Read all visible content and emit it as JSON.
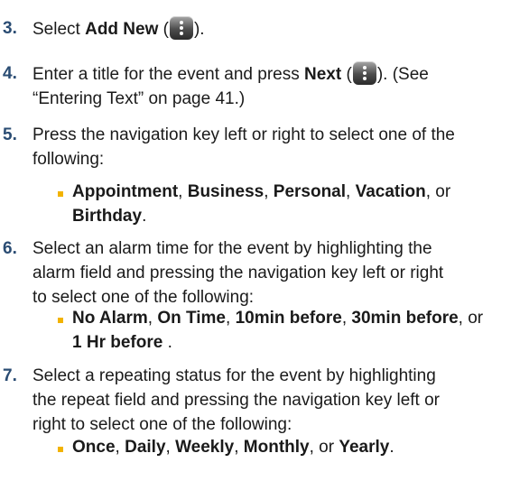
{
  "step3": {
    "num": "3.",
    "pre": "Select ",
    "bold": "Add New",
    "open": " (",
    "close": ")."
  },
  "step4": {
    "num": "4.",
    "line1_pre": "Enter a title for the event and press ",
    "bold": "Next",
    "open": " (",
    "close": "). (See",
    "line2": "“Entering Text” on page 41.)"
  },
  "step5": {
    "num": "5.",
    "line1": "Press the navigation key left or right to select one of the",
    "line2": "following:",
    "options_line1": [
      "Appointment",
      ", ",
      "Business",
      ", ",
      "Personal",
      ", ",
      "Vacation",
      ", or"
    ],
    "options_line2": "Birthday",
    "options_end": "."
  },
  "step6": {
    "num": "6.",
    "line1": "Select an alarm time for the event by highlighting the",
    "line2": "alarm field and pressing the navigation key left or right",
    "line3": "to select one of the following:",
    "options_line1": [
      "No Alarm",
      ", ",
      "On Time",
      ", ",
      "10min before",
      ", ",
      "30min before",
      ", or"
    ],
    "options_line2": "1 Hr before",
    "options_end": " ."
  },
  "step7": {
    "num": "7.",
    "line1": "Select a repeating status for the event by highlighting",
    "line2": "the repeat field and pressing the navigation key left or",
    "line3": "right to select one of the following:",
    "options": [
      "Once",
      ", ",
      "Daily",
      ", ",
      "Weekly",
      ", ",
      "Monthly",
      ", or ",
      "Yearly",
      "."
    ]
  },
  "icons": {
    "menu_key": "menu-key-icon"
  },
  "colors": {
    "step_number": "#2a4c73",
    "bullet": "#f2b300",
    "text": "#1a1a1a"
  }
}
